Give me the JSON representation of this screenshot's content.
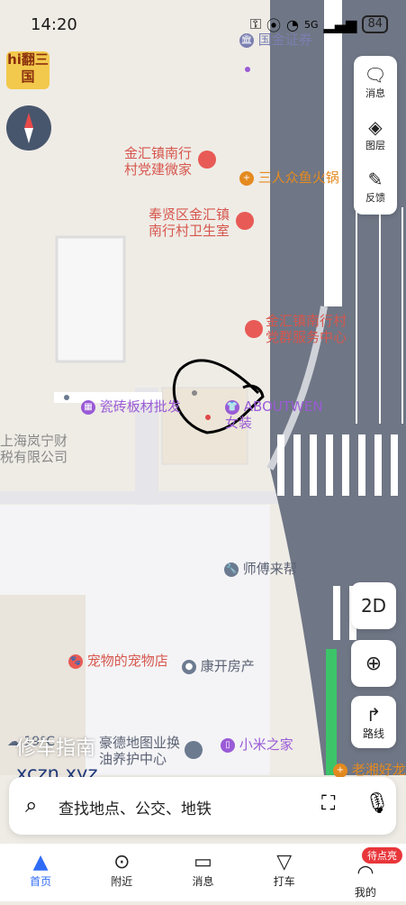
{
  "status": {
    "time": "14:20",
    "battery": "84",
    "network": "5G"
  },
  "map": {
    "pois": [
      {
        "name": "国金证券"
      },
      {
        "name": "金汇镇南行村党建微家"
      },
      {
        "name": "三人众鱼火锅"
      },
      {
        "name": "奉贤区金汇镇南行村卫生室"
      },
      {
        "name": "金汇镇南行村党群服务中心"
      },
      {
        "name": "瓷砖板材批发"
      },
      {
        "name": "ABOUTWEN女装"
      },
      {
        "name": "上海岚宁财税有限公司"
      },
      {
        "name": "师傅来帮"
      },
      {
        "name": "宠物的宠物店"
      },
      {
        "name": "康开房产"
      },
      {
        "name": "小米之家"
      },
      {
        "name": "豪德地图业换油养护中心"
      },
      {
        "name": "老湘好龙"
      }
    ],
    "weather": "19°C"
  },
  "tools": {
    "message": "消息",
    "layers": "图层",
    "feedback": "反馈"
  },
  "buttons": {
    "mode": "2D",
    "route": "路线"
  },
  "search": {
    "placeholder": "查找地点、公交、地铁"
  },
  "watermark": {
    "line1": "修车指南",
    "line2": "xczn.xyz"
  },
  "nav": [
    {
      "label": "首页"
    },
    {
      "label": "附近"
    },
    {
      "label": "消息"
    },
    {
      "label": "打车"
    },
    {
      "label": "我的",
      "badge": "待点亮"
    }
  ],
  "logo": {
    "text": "hi翻三国"
  }
}
